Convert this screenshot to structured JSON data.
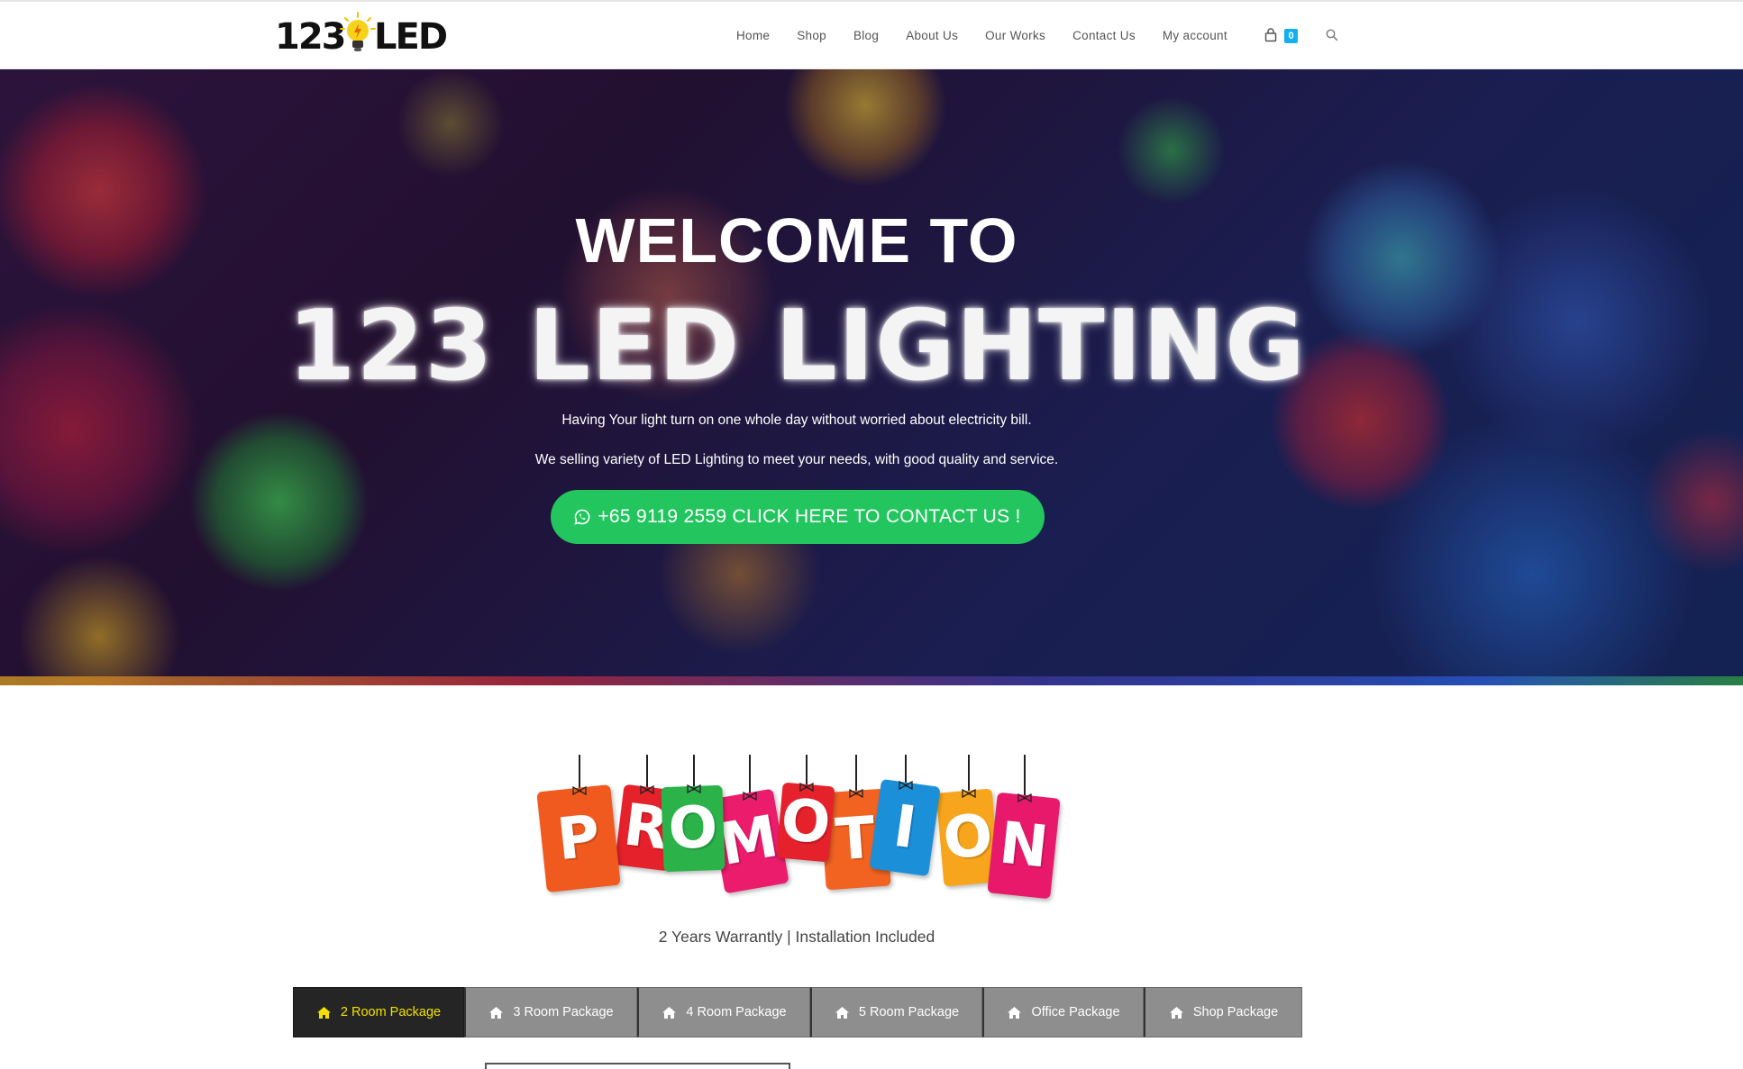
{
  "header": {
    "logo": {
      "text_left": "123",
      "text_right": "LED",
      "icon": "lightbulb-icon"
    },
    "nav": [
      "Home",
      "Shop",
      "Blog",
      "About Us",
      "Our Works",
      "Contact Us",
      "My account"
    ],
    "cart": {
      "icon": "shopping-bag-icon",
      "count": "0"
    },
    "search_icon": "search-icon"
  },
  "hero": {
    "title_line_1": "WELCOME TO",
    "title_line_2": "123 LED LIGHTING",
    "text_1": "Having Your light turn on one whole day without worried about electricity bill.",
    "text_2": "We selling variety of LED Lighting to meet your needs, with good quality and service.",
    "cta": {
      "icon": "whatsapp-icon",
      "label": "+65 9119 2559 CLICK HERE TO CONTACT US !"
    }
  },
  "promotion": {
    "letters": [
      "P",
      "R",
      "O",
      "M",
      "O",
      "T",
      "I",
      "O",
      "N"
    ],
    "colors": [
      "#f05a1e",
      "#e5212b",
      "#2bb34a",
      "#ec1c6c",
      "#e5212b",
      "#f26322",
      "#1b8fd8",
      "#f7a51c",
      "#e8196b"
    ]
  },
  "subtitle": "2 Years Warrantly | Installation Included",
  "tabs": [
    {
      "label": "2 Room Package",
      "icon": "home-icon",
      "active": true
    },
    {
      "label": "3 Room Package",
      "icon": "home-icon",
      "active": false
    },
    {
      "label": "4 Room Package",
      "icon": "home-icon",
      "active": false
    },
    {
      "label": "5 Room Package",
      "icon": "home-icon",
      "active": false
    },
    {
      "label": "Office Package",
      "icon": "home-icon",
      "active": false
    },
    {
      "label": "Shop Package",
      "icon": "home-icon",
      "active": false
    }
  ],
  "colors": {
    "accent": "#13aff0",
    "cta": "#22c55e",
    "tab_active_bg": "#252525",
    "tab_active_text": "#f2e100",
    "tab_bg": "#8e8e8e"
  }
}
